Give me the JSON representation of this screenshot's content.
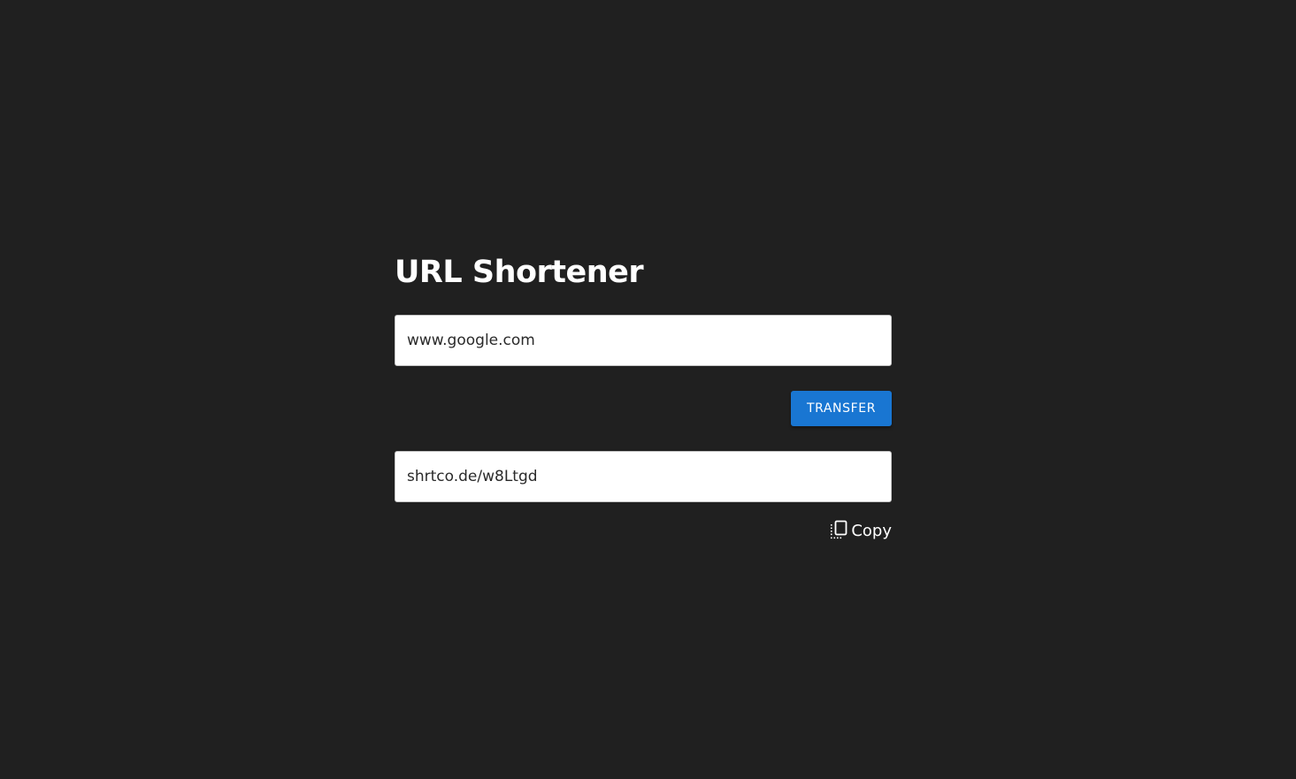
{
  "app": {
    "title": "URL Shortener"
  },
  "form": {
    "url_input_value": "www.google.com",
    "transfer_button_label": "TRANSFER",
    "result_value": "shrtco.de/w8Ltgd",
    "copy_label": "Copy",
    "copy_icon": "copy-icon"
  },
  "colors": {
    "background": "#202020",
    "primary_button": "#1976d2",
    "title_text": "#ffffff"
  }
}
